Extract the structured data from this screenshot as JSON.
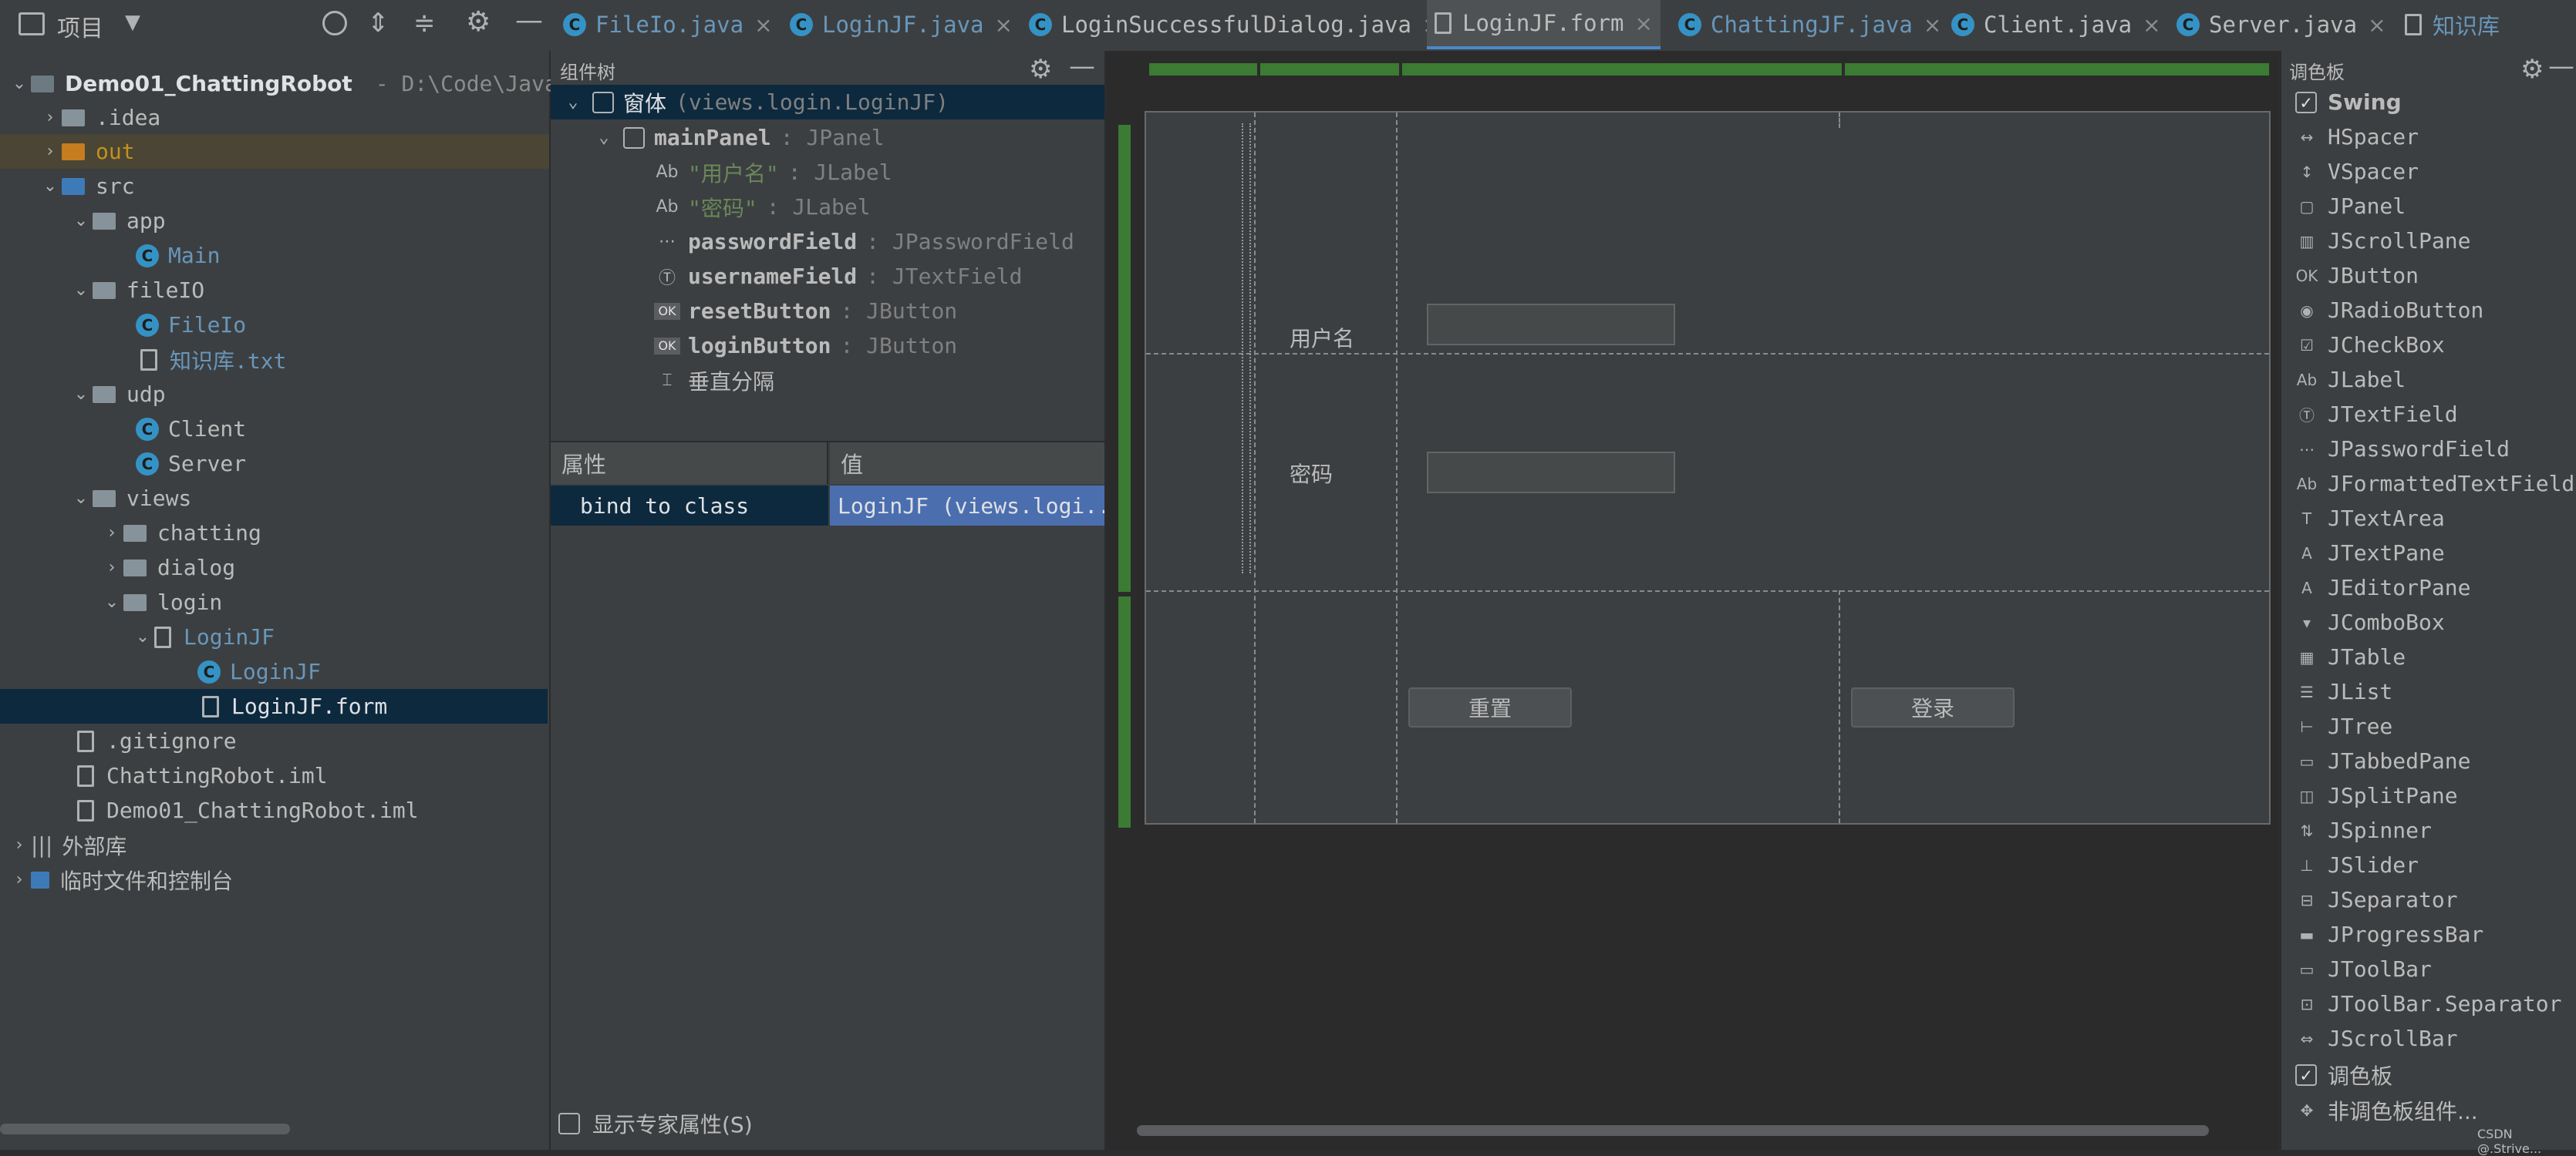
{
  "project": {
    "title": "项目",
    "root_name": "Demo01_ChattingRobot",
    "root_path": "- D:\\Code\\JavaCo",
    "items": [
      {
        "label": ".idea"
      },
      {
        "label": "out"
      },
      {
        "label": "src"
      },
      {
        "label": "app"
      },
      {
        "label": "Main"
      },
      {
        "label": "fileIO"
      },
      {
        "label": "FileIo"
      },
      {
        "label": "知识库.txt"
      },
      {
        "label": "udp"
      },
      {
        "label": "Client"
      },
      {
        "label": "Server"
      },
      {
        "label": "views"
      },
      {
        "label": "chatting"
      },
      {
        "label": "dialog"
      },
      {
        "label": "login"
      },
      {
        "label": "LoginJF"
      },
      {
        "label": "LoginJF"
      },
      {
        "label": "LoginJF.form"
      },
      {
        "label": ".gitignore"
      },
      {
        "label": "ChattingRobot.iml"
      },
      {
        "label": "Demo01_ChattingRobot.iml"
      },
      {
        "label": "外部库"
      },
      {
        "label": "临时文件和控制台"
      }
    ]
  },
  "tabs": [
    {
      "label": "FileIo.java"
    },
    {
      "label": "LoginJF.java"
    },
    {
      "label": "LoginSuccessfulDialog.java"
    },
    {
      "label": "LoginJF.form"
    },
    {
      "label": "ChattingJF.java"
    },
    {
      "label": "Client.java"
    },
    {
      "label": "Server.java"
    },
    {
      "label": "知识库"
    }
  ],
  "component_tree": {
    "title": "组件树",
    "rows": [
      {
        "name": "窗体",
        "type": "(views.login.LoginJF)"
      },
      {
        "name": "mainPanel",
        "type": ": JPanel"
      },
      {
        "name": "\"用户名\"",
        "type": ": JLabel"
      },
      {
        "name": "\"密码\"",
        "type": ": JLabel"
      },
      {
        "name": "passwordField",
        "type": ": JPasswordField"
      },
      {
        "name": "usernameField",
        "type": ": JTextField"
      },
      {
        "name": "resetButton",
        "type": ": JButton"
      },
      {
        "name": "loginButton",
        "type": ": JButton"
      },
      {
        "name": "垂直分隔",
        "type": ""
      }
    ]
  },
  "properties": {
    "col_name": "属性",
    "col_value": "值",
    "rows": [
      {
        "name": "bind to class",
        "value": "LoginJF (views.logi..."
      }
    ],
    "expert_label": "显示专家属性(S)"
  },
  "form": {
    "username_label": "用户名",
    "password_label": "密码",
    "reset_button": "重置",
    "login_button": "登录"
  },
  "palette": {
    "title": "调色板",
    "group": "Swing",
    "items": [
      "HSpacer",
      "VSpacer",
      "JPanel",
      "JScrollPane",
      "JButton",
      "JRadioButton",
      "JCheckBox",
      "JLabel",
      "JTextField",
      "JPasswordField",
      "JFormattedTextField",
      "JTextArea",
      "JTextPane",
      "JEditorPane",
      "JComboBox",
      "JTable",
      "JList",
      "JTree",
      "JTabbedPane",
      "JSplitPane",
      "JSpinner",
      "JSlider",
      "JSeparator",
      "JProgressBar",
      "JToolBar",
      "JToolBar.Separator",
      "JScrollBar"
    ],
    "footer_group": "调色板",
    "footer_item": "非调色板组件..."
  },
  "watermark": "CSDN @.Strive..."
}
